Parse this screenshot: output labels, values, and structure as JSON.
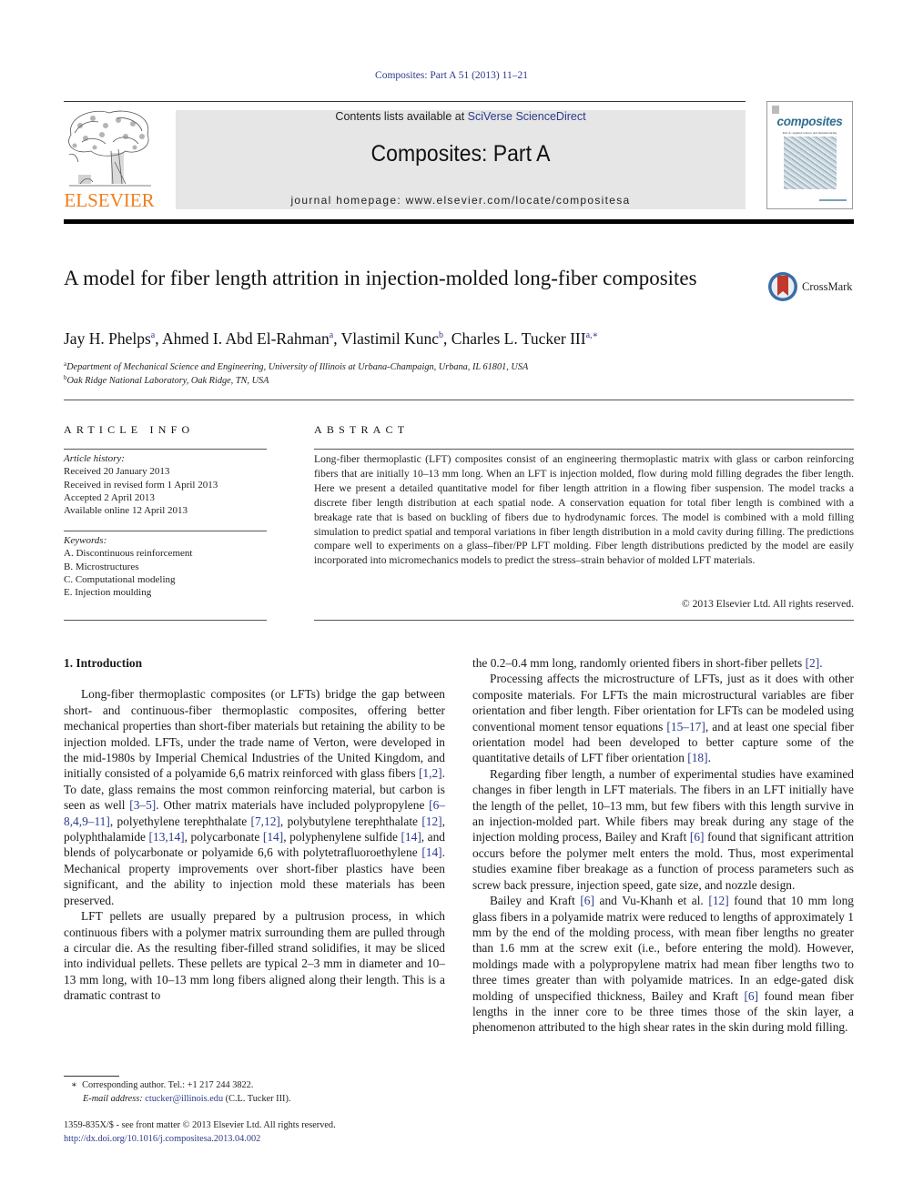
{
  "citation": "Composites: Part A 51 (2013) 11–21",
  "publisher": {
    "name": "ELSEVIER",
    "color": "#f07f1e"
  },
  "masthead": {
    "contents_prefix": "Contents lists available at ",
    "contents_link": "SciVerse ScienceDirect",
    "journal_title": "Composites: Part A",
    "homepage_label": "journal homepage: ",
    "homepage_url": "www.elsevier.com/locate/compositesa"
  },
  "cover": {
    "title": "composites",
    "subtitle": "Part A: applied science and manufacturing"
  },
  "crossmark": {
    "label": "CrossMark"
  },
  "article": {
    "title": "A model for fiber length attrition in injection-molded long-fiber composites",
    "authors": [
      {
        "name": "Jay H. Phelps",
        "sup": "a"
      },
      {
        "name": "Ahmed I. Abd El-Rahman",
        "sup": "a"
      },
      {
        "name": "Vlastimil Kunc",
        "sup": "b"
      },
      {
        "name": "Charles L. Tucker III",
        "sup": "a,∗"
      }
    ],
    "affiliations": [
      {
        "sup": "a",
        "text": "Department of Mechanical Science and Engineering, University of Illinois at Urbana-Champaign, Urbana, IL 61801, USA"
      },
      {
        "sup": "b",
        "text": "Oak Ridge National Laboratory, Oak Ridge, TN, USA"
      }
    ]
  },
  "article_info": {
    "heading": "ARTICLE INFO",
    "history_label": "Article history:",
    "history": [
      "Received 20 January 2013",
      "Received in revised form 1 April 2013",
      "Accepted 2 April 2013",
      "Available online 12 April 2013"
    ],
    "keywords_label": "Keywords:",
    "keywords": [
      "A. Discontinuous reinforcement",
      "B. Microstructures",
      "C. Computational modeling",
      "E. Injection moulding"
    ]
  },
  "abstract": {
    "heading": "ABSTRACT",
    "text": "Long-fiber thermoplastic (LFT) composites consist of an engineering thermoplastic matrix with glass or carbon reinforcing fibers that are initially 10–13 mm long. When an LFT is injection molded, flow during mold filling degrades the fiber length. Here we present a detailed quantitative model for fiber length attrition in a flowing fiber suspension. The model tracks a discrete fiber length distribution at each spatial node. A conservation equation for total fiber length is combined with a breakage rate that is based on buckling of fibers due to hydrodynamic forces. The model is combined with a mold filling simulation to predict spatial and temporal variations in fiber length distribution in a mold cavity during filling. The predictions compare well to experiments on a glass–fiber/PP LFT molding. Fiber length distributions predicted by the model are easily incorporated into micromechanics models to predict the stress–strain behavior of molded LFT materials.",
    "copyright": "© 2013 Elsevier Ltd. All rights reserved."
  },
  "body": {
    "section_heading": "1. Introduction",
    "left_paragraphs": [
      [
        {
          "t": "Long-fiber thermoplastic composites (or LFTs) bridge the gap between short- and continuous-fiber thermoplastic composites, offering better mechanical properties than short-fiber materials but retaining the ability to be injection molded. LFTs, under the trade name of Verton, were developed in the mid-1980s by Imperial Chemical Industries of the United Kingdom, and initially consisted of a polyamide 6,6 matrix reinforced with glass fibers "
        },
        {
          "r": "[1,2]"
        },
        {
          "t": ". To date, glass remains the most common reinforcing material, but carbon is seen as well "
        },
        {
          "r": "[3–5]"
        },
        {
          "t": ". Other matrix materials have included polypropylene "
        },
        {
          "r": "[6–8,4,9–11]"
        },
        {
          "t": ", polyethylene terephthalate "
        },
        {
          "r": "[7,12]"
        },
        {
          "t": ", polybutylene terephthalate "
        },
        {
          "r": "[12]"
        },
        {
          "t": ", polyphthalamide "
        },
        {
          "r": "[13,14]"
        },
        {
          "t": ", polycarbonate "
        },
        {
          "r": "[14]"
        },
        {
          "t": ", polyphenylene sulfide "
        },
        {
          "r": "[14]"
        },
        {
          "t": ", and blends of polycarbonate or polyamide 6,6 with polytetrafluoroethylene "
        },
        {
          "r": "[14]"
        },
        {
          "t": ". Mechanical property improvements over short-fiber plastics have been significant, and the ability to injection mold these materials has been preserved."
        }
      ],
      [
        {
          "t": "LFT pellets are usually prepared by a pultrusion process, in which continuous fibers with a polymer matrix surrounding them are pulled through a circular die. As the resulting fiber-filled strand solidifies, it may be sliced into individual pellets. These pellets are typical 2–3 mm in diameter and 10–13 mm long, with 10–13 mm long fibers aligned along their length. This is a dramatic contrast to"
        }
      ]
    ],
    "right_paragraphs": [
      [
        {
          "t": "the 0.2–0.4 mm long, randomly oriented fibers in short-fiber pellets "
        },
        {
          "r": "[2]"
        },
        {
          "t": "."
        }
      ],
      [
        {
          "t": "Processing affects the microstructure of LFTs, just as it does with other composite materials. For LFTs the main microstructural variables are fiber orientation and fiber length. Fiber orientation for LFTs can be modeled using conventional moment tensor equations "
        },
        {
          "r": "[15–17]"
        },
        {
          "t": ", and at least one special fiber orientation model had been developed to better capture some of the quantitative details of LFT fiber orientation "
        },
        {
          "r": "[18]"
        },
        {
          "t": "."
        }
      ],
      [
        {
          "t": "Regarding fiber length, a number of experimental studies have examined changes in fiber length in LFT materials. The fibers in an LFT initially have the length of the pellet, 10–13 mm, but few fibers with this length survive in an injection-molded part. While fibers may break during any stage of the injection molding process, Bailey and Kraft "
        },
        {
          "r": "[6]"
        },
        {
          "t": " found that significant attrition occurs before the polymer melt enters the mold. Thus, most experimental studies examine fiber breakage as a function of process parameters such as screw back pressure, injection speed, gate size, and nozzle design."
        }
      ],
      [
        {
          "t": "Bailey and Kraft "
        },
        {
          "r": "[6]"
        },
        {
          "t": " and Vu-Khanh et al. "
        },
        {
          "r": "[12]"
        },
        {
          "t": " found that 10 mm long glass fibers in a polyamide matrix were reduced to lengths of approximately 1 mm by the end of the molding process, with mean fiber lengths no greater than 1.6 mm at the screw exit (i.e., before entering the mold). However, moldings made with a polypropylene matrix had mean fiber lengths two to three times greater than with polyamide matrices. In an edge-gated disk molding of unspecified thickness, Bailey and Kraft "
        },
        {
          "r": "[6]"
        },
        {
          "t": " found mean fiber lengths in the inner core to be three times those of the skin layer, a phenomenon attributed to the high shear rates in the skin during mold filling."
        }
      ]
    ]
  },
  "footnote": {
    "marker": "∗",
    "corresponding": "Corresponding author. Tel.: +1 217 244 3822.",
    "email_label": "E-mail address: ",
    "email": "ctucker@illinois.edu",
    "email_suffix": " (C.L. Tucker III)."
  },
  "issn_line": "1359-835X/$ - see front matter © 2013 Elsevier Ltd. All rights reserved.",
  "doi": "http://dx.doi.org/10.1016/j.compositesa.2013.04.002",
  "colors": {
    "link": "#2b3a8c",
    "masthead_bg": "#e6e6e6",
    "elsevier_orange": "#f07f1e",
    "cover_title": "#2f6e8f",
    "crossmark_red": "#c0392b",
    "crossmark_blue": "#3a6ea5"
  }
}
